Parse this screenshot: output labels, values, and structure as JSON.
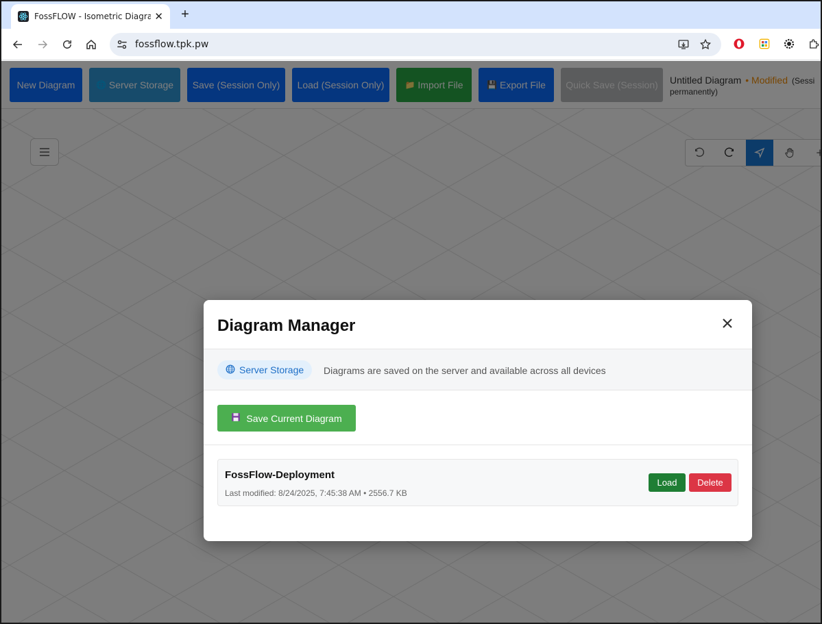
{
  "browser": {
    "tab_title": "FossFLOW - Isometric Diagramming",
    "tab_close": "✕",
    "new_tab": "+",
    "url": "fossflow.tpk.pw"
  },
  "app_toolbar": {
    "new_diagram": "New Diagram",
    "server_storage": "Server Storage",
    "save_session": "Save (Session Only)",
    "load_session": "Load (Session Only)",
    "import_file": "Import File",
    "export_file": "Export File",
    "quick_save": "Quick Save (Session)",
    "diagram_title": "Untitled Diagram",
    "modified": "• Modified",
    "session_note_a": "(Sessi",
    "session_note_b": "permanently)"
  },
  "modal": {
    "title": "Diagram Manager",
    "close": "✕",
    "storage_label": "Server Storage",
    "storage_desc": "Diagrams are saved on the server and available across all devices",
    "save_current": "Save Current Diagram",
    "diagrams": [
      {
        "name": "FossFlow-Deployment",
        "meta": "Last modified: 8/24/2025, 7:45:38 AM • 2556.7 KB",
        "load_label": "Load",
        "delete_label": "Delete"
      }
    ]
  },
  "colors": {
    "primary_blue": "#0b6cff",
    "server_teal": "#2f96d6",
    "import_green": "#28a745",
    "save_green": "#4caf50",
    "delete_red": "#dc3545",
    "modified_orange": "#f08a00"
  }
}
